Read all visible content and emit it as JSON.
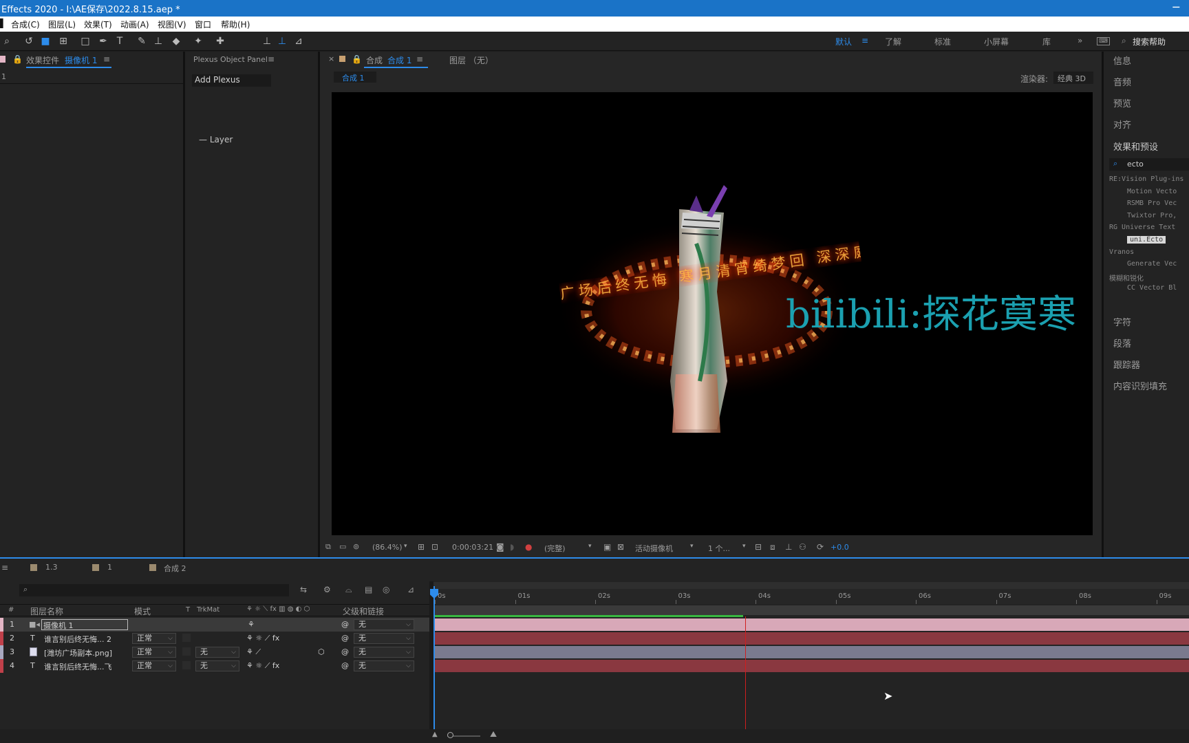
{
  "title_bar": {
    "title": "Effects 2020 - I:\\AE保存\\2022.8.15.aep *",
    "close": "─"
  },
  "menu": [
    "合成(C)",
    "图层(L)",
    "效果(T)",
    "动画(A)",
    "视图(V)",
    "窗口",
    "帮助(H)"
  ],
  "workspaces": [
    "默认",
    "了解",
    "标准",
    "小屏幕",
    "库"
  ],
  "search_help": "搜索帮助",
  "effect_controls": {
    "tab": "效果控件",
    "target": "摄像机 1",
    "row_label": "1"
  },
  "plexus": {
    "tab": "Plexus Object Panel",
    "add_button": "Add Plexus",
    "layer_label": "— Layer"
  },
  "comp_panel": {
    "tab_prefix": "合成",
    "tab_name": "合成 1",
    "layer_tab": "图层 （无）",
    "crumb": "合成 1",
    "renderer_label": "渲染器:",
    "renderer_value": "经典 3D"
  },
  "viewer_footer": {
    "zoom": "(86.4%)",
    "timecode": "0:00:03:21",
    "resolution": "(完整)",
    "camera": "活动摄像机",
    "views": "1 个...",
    "exposure": "+0.0"
  },
  "overlay_text": "bilibili:探花寞寒",
  "ring_text": "广场后终无悔 寒月清宵绮梦回 深深庭院香不共粉云",
  "right_panel": [
    "信息",
    "音频",
    "预览",
    "对齐",
    "效果和预设",
    "字符",
    "段落",
    "跟踪器",
    "内容识别填充"
  ],
  "effects_search": "ecto",
  "effects_tree": [
    {
      "label": "RE:Vision Plug-ins",
      "group": true
    },
    {
      "label": "Motion Vecto",
      "group": false
    },
    {
      "label": "RSMB Pro Vec",
      "group": false
    },
    {
      "label": "Twixtor Pro,",
      "group": false
    },
    {
      "label": "RG Universe Text",
      "group": true
    },
    {
      "label": "uni.Ecto",
      "group": false
    },
    {
      "label": "Vranos",
      "group": true
    },
    {
      "label": "Generate Vec",
      "group": false
    },
    {
      "label": "模糊和锐化",
      "group": true
    },
    {
      "label": "CC Vector Bl",
      "group": false
    }
  ],
  "timeline_tabs": [
    "1.3",
    "1",
    "合成 2"
  ],
  "columns": {
    "num": "#",
    "name": "图层名称",
    "mode": "模式",
    "t": "T",
    "trkmat": "TrkMat",
    "parent": "父级和链接"
  },
  "layers": [
    {
      "num": "1",
      "type": "camera",
      "name": "摄像机 1",
      "mode": "",
      "trkmat": "",
      "parent": "无",
      "color": "#e4b6c6"
    },
    {
      "num": "2",
      "type": "T",
      "name": "谁言别后终无悔... 2",
      "mode": "正常",
      "trkmat": "",
      "parent": "无",
      "color": "#c0404a"
    },
    {
      "num": "3",
      "type": "image",
      "name": "[潍坊广场副本.png]",
      "mode": "正常",
      "trkmat": "无",
      "parent": "无",
      "color": "#a8a8c0"
    },
    {
      "num": "4",
      "type": "T",
      "name": "谁言别后终无悔...飞",
      "mode": "正常",
      "trkmat": "无",
      "parent": "无",
      "color": "#c0404a"
    }
  ],
  "time_ticks": [
    "0s",
    "01s",
    "02s",
    "03s",
    "04s",
    "05s",
    "06s",
    "07s",
    "08s",
    "09s"
  ],
  "playhead_seconds": 3.875,
  "colors": {
    "accent": "#2d8ceb",
    "title_bar": "#1a73c7",
    "layer_camera": "#e4b6c6",
    "layer_text": "#c0404a",
    "layer_image": "#a8a8c0",
    "playhead": "#d01e1e",
    "overlay_text": "#1ba0b0"
  }
}
